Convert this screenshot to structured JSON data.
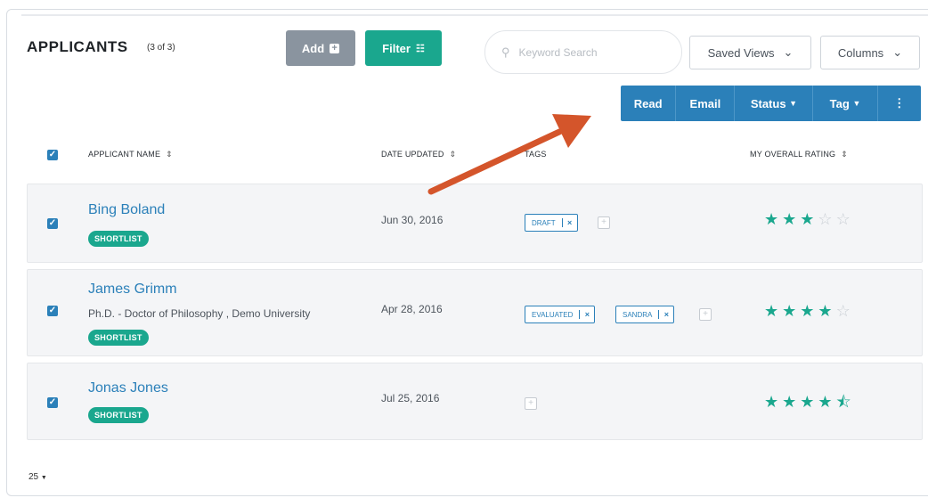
{
  "header": {
    "title": "APPLICANTS",
    "count": "(3 of 3)"
  },
  "toolbar": {
    "add_label": "Add",
    "filter_label": "Filter"
  },
  "search": {
    "placeholder": "Keyword Search"
  },
  "views": {
    "saved_label": "Saved Views",
    "columns_label": "Columns"
  },
  "actions": {
    "read": "Read",
    "email": "Email",
    "status": "Status",
    "tag": "Tag",
    "more": "⋮"
  },
  "columns": {
    "name": "APPLICANT NAME",
    "date": "DATE UPDATED",
    "tags": "TAGS",
    "rating": "MY OVERALL RATING"
  },
  "rows": [
    {
      "name": "Bing Boland",
      "degree": "",
      "badge": "SHORTLIST",
      "date": "Jun 30, 2016",
      "tags": [
        "DRAFT"
      ],
      "rating": 3
    },
    {
      "name": "James Grimm",
      "degree": "Ph.D. - Doctor of Philosophy , Demo University",
      "badge": "SHORTLIST",
      "date": "Apr 28, 2016",
      "tags": [
        "EVALUATED",
        "SANDRA"
      ],
      "rating": 4
    },
    {
      "name": "Jonas Jones",
      "degree": "",
      "badge": "SHORTLIST",
      "date": "Jul 25, 2016",
      "tags": [],
      "rating": 4.5
    }
  ],
  "pagination": {
    "per_page": "25"
  },
  "colors": {
    "accent": "#1aa78e",
    "primary": "#2b80b9",
    "annotation_arrow": "#d4552b"
  }
}
